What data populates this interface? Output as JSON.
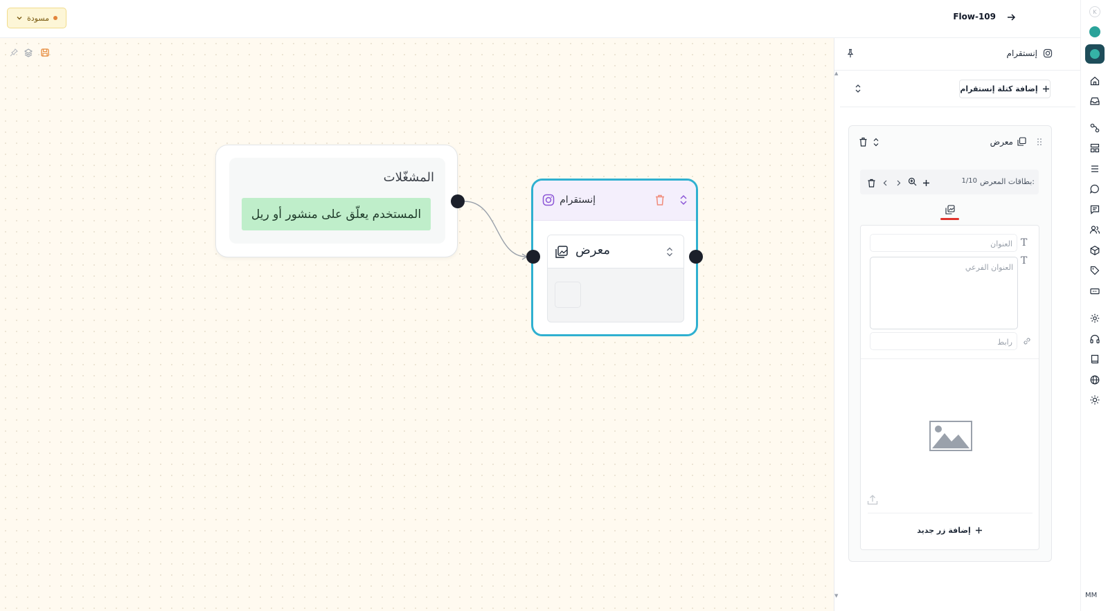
{
  "header": {
    "flow_title": "Flow-109",
    "status_label": "مسودة",
    "colors": {
      "status_bg": "#fdf6d7",
      "status_dot": "#e2843a"
    }
  },
  "rail": {
    "icons": [
      "home-icon",
      "inbox-icon",
      "flow-icon",
      "layout-icon",
      "menu-icon",
      "chat-icon",
      "comment-icon",
      "users-icon",
      "package-icon",
      "tag-icon",
      "ticket-icon",
      "settings-icon",
      "headset-icon",
      "book-icon",
      "globe-icon",
      "sun-icon"
    ],
    "user_initials": "MM"
  },
  "canvas": {
    "toolbar_icons": [
      "pin-icon",
      "layers-icon",
      "save-icon"
    ],
    "trigger_node": {
      "title": "المشغّلات",
      "trigger_text": "المستخدم يعلّق على منشور أو ريل"
    },
    "instagram_node": {
      "title": "إنستقرام",
      "gallery_label": "معرض",
      "colors": {
        "border": "#2fb0d0",
        "header_bg": "#f4effc",
        "trash": "#f08b7a"
      }
    }
  },
  "panel": {
    "title": "إنستقرام",
    "add_block_label": "إضافة كتلة إنستقرام",
    "block": {
      "title": "معرض",
      "cards_label": "بطاقات المعرض:",
      "cards_count": "1/10",
      "title_placeholder": "العنوان",
      "subtitle_placeholder": "العنوان الفرعي",
      "link_placeholder": "رابط",
      "add_button_label": "إضافة زر جديد"
    },
    "colors": {
      "tab_underline": "#e0322b"
    }
  }
}
